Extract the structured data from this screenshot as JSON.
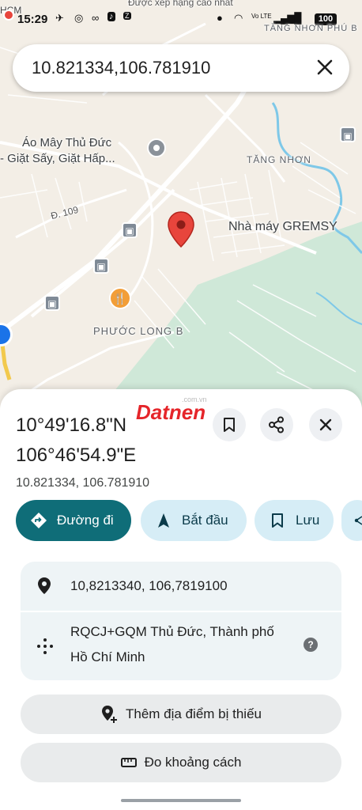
{
  "status_bar": {
    "time": "15:29",
    "network_label": "Vo LTE",
    "battery": "100"
  },
  "map": {
    "top_banner_text": "Được xếp hạng cao nhất",
    "labels": {
      "hcm": "HCM",
      "tang_nhon_phu_top": "TĂNG NHƠN PHÚ B",
      "tang_nhon_phu": "TĂNG NHƠN",
      "shop_line1": "Áo Mây Thủ Đức",
      "shop_line2": "- Giặt Sấy, Giặt Hấp...",
      "road": "Đ. 109",
      "factory": "Nhà máy GREMSY",
      "district": "PHƯỚC LONG B"
    },
    "colors": {
      "land": "#f3eee6",
      "park": "#cfe8d8",
      "road": "#ffffff",
      "water": "#7ec8e8",
      "pin": "#e8453c"
    }
  },
  "search": {
    "query": "10.821334,106.781910"
  },
  "watermark": {
    "brand": "Datnen",
    "domain": ".com.vn"
  },
  "place": {
    "dms_lat": "10°49'16.8\"N",
    "dms_lng": "106°46'54.9\"E",
    "decimal": "10.821334, 106.781910"
  },
  "actions": {
    "directions": "Đường đi",
    "start": "Bắt đầu",
    "save": "Lưu"
  },
  "details": {
    "coords": "10,8213340, 106,7819100",
    "plus_code_line1": "RQCJ+GQM Thủ Đức, Thành phố",
    "plus_code_line2": "Hồ Chí Minh",
    "help": "?"
  },
  "buttons": {
    "add_missing_place": "Thêm địa điểm bị thiếu",
    "measure_distance": "Đo khoảng cách"
  },
  "accent_colors": {
    "primary": "#0f6d78",
    "chip": "#d6edf6",
    "watermark": "#e5252a"
  }
}
